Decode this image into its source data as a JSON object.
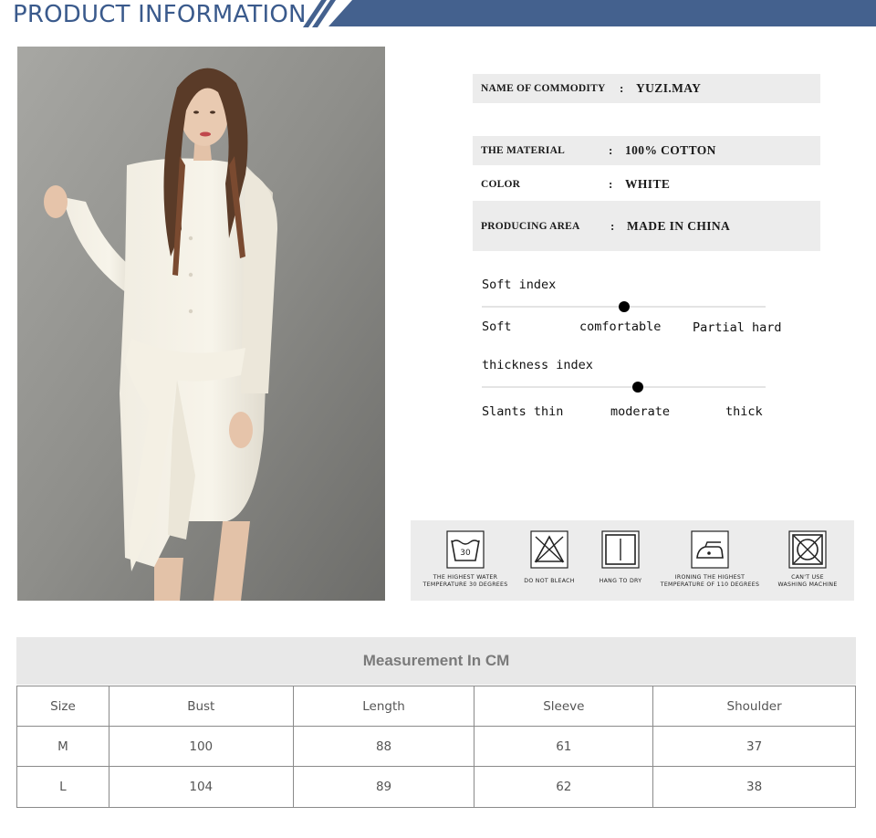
{
  "header": {
    "title": "PRODUCT INFORMATION"
  },
  "info": [
    {
      "key": "NAME OF COMMODITY",
      "value": "YUZI.MAY"
    },
    {
      "key": "THE MATERIAL",
      "value": "100% COTTON"
    },
    {
      "key": "COLOR",
      "value": "WHITE"
    },
    {
      "key": "PRODUCING AREA",
      "value": "MADE IN CHINA"
    }
  ],
  "soft_index": {
    "title": "Soft index",
    "labels": [
      "Soft",
      "comfortable",
      "Partial hard"
    ],
    "selected": "comfortable",
    "level": 0.5
  },
  "thickness_index": {
    "title": "thickness index",
    "labels": [
      "Slants thin",
      "moderate",
      "thick"
    ],
    "selected": "moderate",
    "level": 0.55
  },
  "care": [
    {
      "icon": "wash-30-icon",
      "label1": "THE HIGHEST WATER",
      "label2": "TEMPERATURE 30 DEGREES",
      "tub_text": "30"
    },
    {
      "icon": "do-not-bleach-icon",
      "label1": "DO NOT BLEACH",
      "label2": ""
    },
    {
      "icon": "hang-to-dry-icon",
      "label1": "HANG TO DRY",
      "label2": ""
    },
    {
      "icon": "iron-110-icon",
      "label1": "IRONING THE HIGHEST",
      "label2": "TEMPERATURE OF 110 DEGREES"
    },
    {
      "icon": "no-machine-wash-icon",
      "label1": "CAN'T USE",
      "label2": "WASHING MACHINE"
    }
  ],
  "measurement": {
    "title": "Measurement In CM",
    "columns": [
      "Size",
      "Bust",
      "Length",
      "Sleeve",
      "Shoulder"
    ],
    "rows": [
      [
        "M",
        "100",
        "88",
        "61",
        "37"
      ],
      [
        "L",
        "104",
        "89",
        "62",
        "38"
      ]
    ]
  },
  "colors": {
    "header_blue": "#44618e",
    "title_blue": "#3a5a8c",
    "panel_gray": "#ececec"
  }
}
